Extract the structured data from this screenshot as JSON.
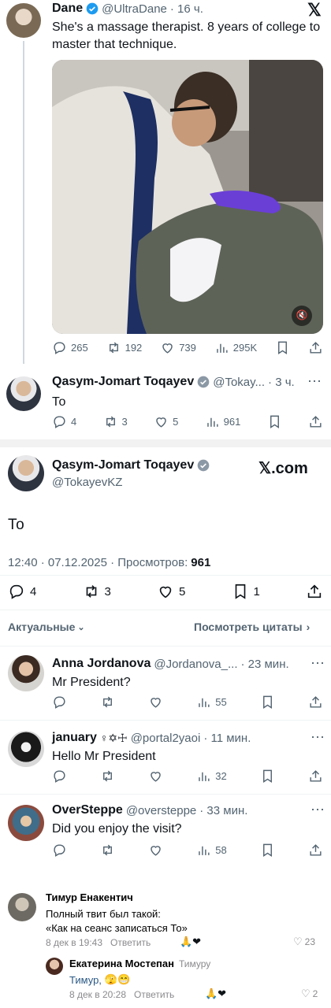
{
  "tweet1": {
    "name": "Dane",
    "handle": "@UltraDane",
    "time": "· 16 ч.",
    "text": "She's a massage therapist. 8 years of college to master that technique.",
    "replies": "265",
    "retweets": "192",
    "likes": "739",
    "views": "295K"
  },
  "tweet2": {
    "name": "Qasym-Jomart Toqayev",
    "handle": "@Tokay...",
    "time": "· 3 ч.",
    "text": "То",
    "replies": "4",
    "retweets": "3",
    "likes": "5",
    "views": "961"
  },
  "main": {
    "name": "Qasym-Jomart Toqayev",
    "handle": "@TokayevKZ",
    "brand": "𝕏.com",
    "text": "То",
    "timestamp": "12:40 · 07.12.2025 · Просмотров:",
    "views": "961",
    "replies": "4",
    "retweets": "3",
    "likes": "5",
    "bookmarks": "1",
    "sort_label": "Актуальные",
    "quotes_label": "Посмотреть цитаты"
  },
  "replies": [
    {
      "name": "Anna Jordanova",
      "handle": "@Jordanova_...",
      "time": "· 23 мин.",
      "text": "Mr President?",
      "views": "55"
    },
    {
      "name": "january",
      "handle": "@portal2yaoi",
      "time": "· 11 мин.",
      "text": "Hello Mr President",
      "views": "32",
      "name_suffix": "♀✡☩"
    },
    {
      "name": "OverSteppe",
      "handle": "@oversteppe",
      "time": "· 33 мин.",
      "text": "Did you enjoy the visit?",
      "views": "58"
    }
  ],
  "telegram": {
    "c1": {
      "name": "Тимур Енакентич",
      "line1": "Полный твит был такой:",
      "line2": "«Как на сеанс записаться То»",
      "date": "8 дек в 19:43",
      "reply": "Ответить",
      "likes": "23"
    },
    "c2": {
      "name": "Екатерина Мостепан",
      "to": "Тимуру",
      "text_name": "Тимур,",
      "date": "8 дек в 20:28",
      "reply": "Ответить",
      "likes": "2"
    }
  },
  "colors": {
    "verified": "#1d9bf0",
    "link": "#2a5885"
  }
}
